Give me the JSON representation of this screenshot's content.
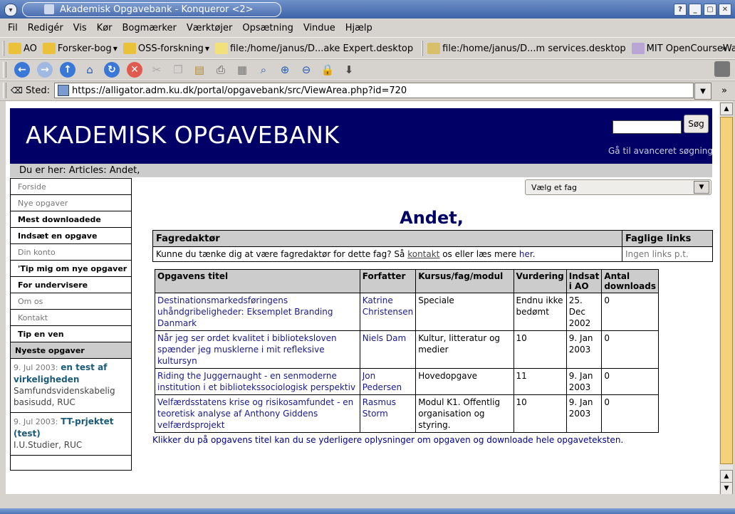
{
  "window": {
    "title": "Akademisk Opgavebank - Konqueror <2>",
    "buttons": [
      "?",
      "_",
      "▢",
      "✕"
    ]
  },
  "menubar": [
    "Fil",
    "Redigér",
    "Vis",
    "Kør",
    "Bogmærker",
    "Værktøjer",
    "Opsætning",
    "Vindue",
    "Hjælp"
  ],
  "bookmarks": [
    {
      "label": "AO",
      "dropdown": false
    },
    {
      "label": "Forsker-bog",
      "dropdown": true
    },
    {
      "label": "OSS-forskning",
      "dropdown": true
    },
    {
      "label": "file:/home/janus/D...ake Expert.desktop",
      "dropdown": false
    },
    {
      "label": "file:/home/janus/D...m services.desktop",
      "dropdown": false
    },
    {
      "label": "MIT OpenCourseWare |",
      "dropdown": false
    }
  ],
  "location": {
    "label": "Sted:",
    "url": "https://alligator.adm.ku.dk/portal/opgavebank/src/ViewArea.php?id=720"
  },
  "site": {
    "logo": "AKADEMISK OPGAVEBANK",
    "search_button": "Søg",
    "advanced_search": "Gå til avanceret søgning",
    "breadcrumb": "Du er her: Articles: Andet,"
  },
  "nav": {
    "items": [
      {
        "label": "Forside",
        "style": "grey"
      },
      {
        "label": "Nye opgaver",
        "style": "grey"
      },
      {
        "label": "Mest downloadede",
        "style": "bold"
      },
      {
        "label": "Indsæt en opgave",
        "style": "bold"
      },
      {
        "label": "Din konto",
        "style": "grey"
      },
      {
        "label": "'Tip mig om nye opgaver",
        "style": "bold"
      },
      {
        "label": "For undervisere",
        "style": "bold"
      },
      {
        "label": "Om os",
        "style": "grey"
      },
      {
        "label": "Kontakt",
        "style": "grey"
      },
      {
        "label": "Tip en ven",
        "style": "bold"
      }
    ],
    "newest_heading": "Nyeste opgaver",
    "newest": [
      {
        "date": "9. Jul 2003:",
        "title": "en test af virkeligheden",
        "org": "Samfundsvidenskabelig basisudd, RUC"
      },
      {
        "date": "9. Jul 2003:",
        "title": "TT-prjektet (test)",
        "org": "I.U.Studier, RUC"
      }
    ]
  },
  "subject_select": "Vælg et fag",
  "heading": "Andet,",
  "editor_table": {
    "headers": [
      "Fagredaktør",
      "Faglige links"
    ],
    "text_before": "Kunne du tænke dig at være fagredaktør for dette fag? Så ",
    "contact_link": "kontakt",
    "text_middle": " os eller læs mere ",
    "more_link": "her",
    "text_after": ".",
    "links_text": "Ingen links p.t."
  },
  "assignments": {
    "headers": [
      "Opgavens titel",
      "Forfatter",
      "Kursus/fag/modul",
      "Vurdering",
      "Indsat i AO",
      "Antal downloads"
    ],
    "rows": [
      [
        "Destinationsmarkedsføringens uhåndgribeligheder: Eksemplet Branding Danmark",
        "Katrine Christensen",
        "Speciale",
        "Endnu ikke bedømt",
        "25. Dec 2002",
        "0"
      ],
      [
        "Når jeg ser ordet kvalitet i biblioteksloven spænder jeg musklerne i mit refleksive kultursyn",
        "Niels Dam",
        "Kultur, litteratur og medier",
        "10",
        "9. Jan 2003",
        "0"
      ],
      [
        "Riding the Juggernaught - en senmoderne institution i et bibliotekssociologisk perspektiv",
        "Jon Pedersen",
        "Hovedopgave",
        "11",
        "9. Jan 2003",
        "0"
      ],
      [
        "Velfærdsstatens krise og risikosamfundet - en teoretisk analyse af Anthony Giddens velfærdsprojekt",
        "Rasmus Storm",
        "Modul K1. Offentlig organisation og styring.",
        "10",
        "9. Jan 2003",
        "0"
      ]
    ]
  },
  "footer_note": "Klikker du på opgavens titel kan du se yderligere oplysninger om opgaven og downloade hele opgaveteksten."
}
